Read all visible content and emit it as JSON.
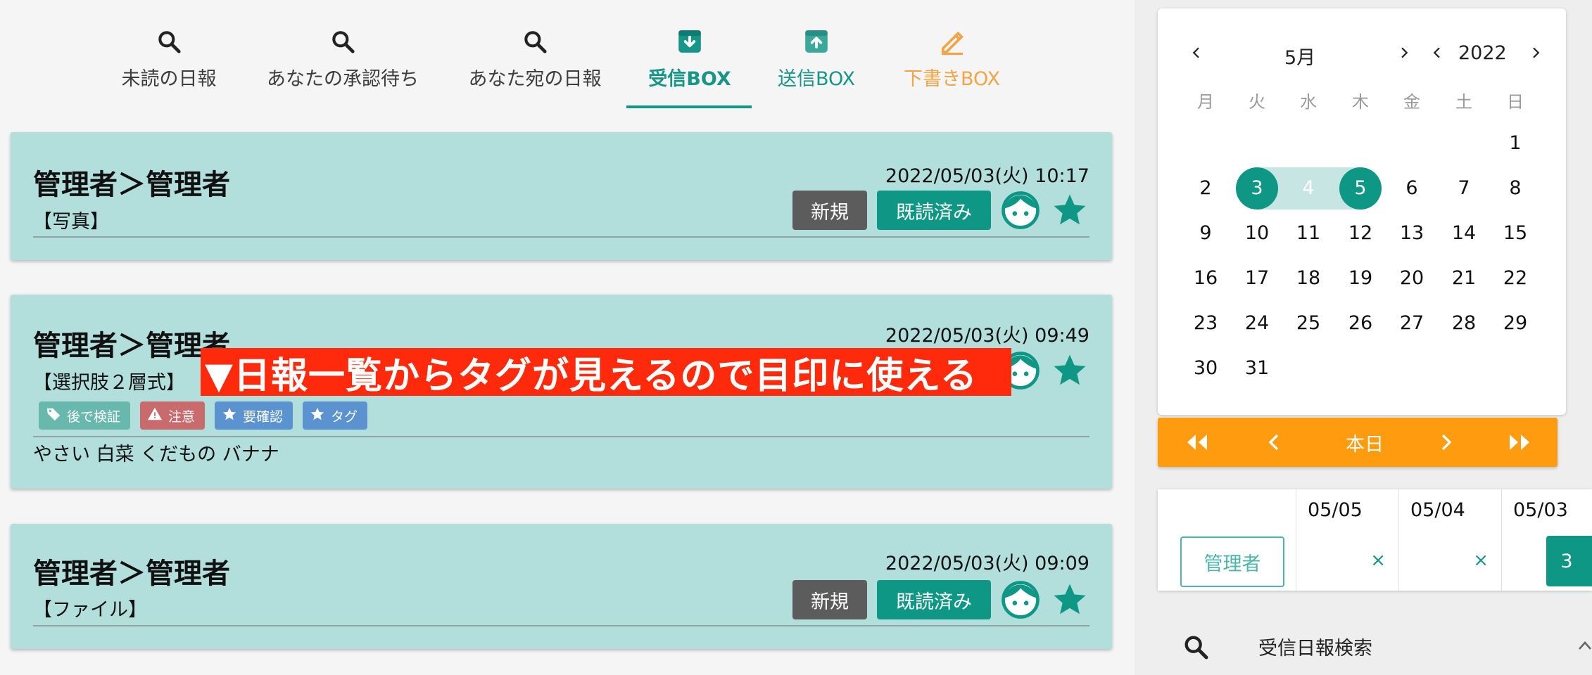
{
  "tabs": [
    {
      "label": "未読の日報",
      "icon": "search-icon"
    },
    {
      "label": "あなたの承認待ち",
      "icon": "search-icon"
    },
    {
      "label": "あなた宛の日報",
      "icon": "search-icon"
    },
    {
      "label": "受信BOX",
      "icon": "inbox-download-icon",
      "active": true
    },
    {
      "label": "送信BOX",
      "icon": "outbox-upload-icon"
    },
    {
      "label": "下書きBOX",
      "icon": "pencil-icon"
    }
  ],
  "colors": {
    "accent": "#0f9786",
    "card_bg": "#b2dfdb",
    "orange": "#ff9b0f",
    "draft": "#f3a446",
    "overlay": "#ff2a0c"
  },
  "reports": [
    {
      "title": "管理者＞管理者",
      "subtitle": "【写真】",
      "datetime": "2022/05/03(火) 10:17",
      "new_label": "新規",
      "read_label": "既読済み"
    },
    {
      "title": "管理者＞管理者",
      "subtitle": "【選択肢２層式】",
      "datetime": "2022/05/03(火) 09:49",
      "tags": [
        {
          "label": "後で検証",
          "icon": "tag-icon",
          "color": "#68b8ae"
        },
        {
          "label": "注意",
          "icon": "warning-icon",
          "color": "#c96a6d"
        },
        {
          "label": "要確認",
          "icon": "star-icon",
          "color": "#5a93cf"
        },
        {
          "label": "タグ",
          "icon": "star-icon",
          "color": "#5a93cf"
        }
      ],
      "body": "やさい 白菜 くだもの バナナ"
    },
    {
      "title": "管理者＞管理者",
      "subtitle": "【ファイル】",
      "datetime": "2022/05/03(火) 09:09",
      "new_label": "新規",
      "read_label": "既読済み"
    }
  ],
  "overlay_text": "▼日報一覧からタグが見えるので目印に使える",
  "calendar": {
    "month": "5月",
    "year": "2022",
    "weekdays": [
      "月",
      "火",
      "水",
      "木",
      "金",
      "土",
      "日"
    ],
    "weeks": [
      [
        "",
        "",
        "",
        "",
        "",
        "",
        "1"
      ],
      [
        "2",
        "3",
        "4",
        "5",
        "6",
        "7",
        "8"
      ],
      [
        "9",
        "10",
        "11",
        "12",
        "13",
        "14",
        "15"
      ],
      [
        "16",
        "17",
        "18",
        "19",
        "20",
        "21",
        "22"
      ],
      [
        "23",
        "24",
        "25",
        "26",
        "27",
        "28",
        "29"
      ],
      [
        "30",
        "31",
        "",
        "",
        "",
        "",
        ""
      ]
    ],
    "range_start": "3",
    "range_end": "5"
  },
  "nav_bar": {
    "today_label": "本日"
  },
  "date_filter": {
    "user_button": "管理者",
    "dates": [
      "05/05",
      "05/04",
      "05/03"
    ],
    "remove_symbol": "×",
    "count": "3"
  },
  "search_section": {
    "label": "受信日報検索"
  }
}
